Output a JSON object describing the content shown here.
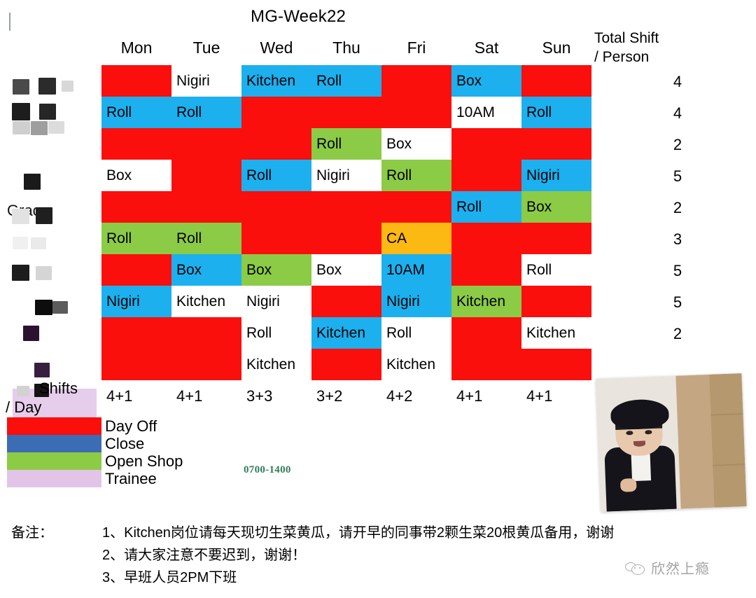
{
  "title": "MG-Week22",
  "header": {
    "days": [
      "Mon",
      "Tue",
      "Wed",
      "Thu",
      "Fri",
      "Sat",
      "Sun"
    ],
    "total_line1": "Total Shift",
    "total_line2": "/ Person"
  },
  "name_column": {
    "visible_name": "Grace",
    "redacted": true
  },
  "schedule": {
    "rows": [
      {
        "total": "4",
        "cells": [
          {
            "day": "Mon",
            "text": "",
            "color": "red"
          },
          {
            "day": "Tue",
            "text": "Nigiri",
            "color": "white"
          },
          {
            "day": "Wed",
            "text": "Kitchen",
            "color": "blue"
          },
          {
            "day": "Thu",
            "text": "Roll",
            "color": "blue"
          },
          {
            "day": "Fri",
            "text": "",
            "color": "red"
          },
          {
            "day": "Sat",
            "text": "Box",
            "color": "blue"
          },
          {
            "day": "Sun",
            "text": "",
            "color": "red"
          }
        ]
      },
      {
        "total": "4",
        "cells": [
          {
            "day": "Mon",
            "text": "Roll",
            "color": "blue"
          },
          {
            "day": "Tue",
            "text": "Roll",
            "color": "blue"
          },
          {
            "day": "Wed",
            "text": "",
            "color": "red"
          },
          {
            "day": "Thu",
            "text": "",
            "color": "red"
          },
          {
            "day": "Fri",
            "text": "",
            "color": "red"
          },
          {
            "day": "Sat",
            "text": "10AM",
            "color": "white"
          },
          {
            "day": "Sun",
            "text": "Roll",
            "color": "blue"
          }
        ]
      },
      {
        "total": "2",
        "cells": [
          {
            "day": "Mon",
            "text": "",
            "color": "red"
          },
          {
            "day": "Tue",
            "text": "",
            "color": "red"
          },
          {
            "day": "Wed",
            "text": "",
            "color": "red"
          },
          {
            "day": "Thu",
            "text": "Roll",
            "color": "green"
          },
          {
            "day": "Fri",
            "text": "Box",
            "color": "white"
          },
          {
            "day": "Sat",
            "text": "",
            "color": "red"
          },
          {
            "day": "Sun",
            "text": "",
            "color": "red"
          }
        ]
      },
      {
        "total": "5",
        "cells": [
          {
            "day": "Mon",
            "text": "Box",
            "color": "white"
          },
          {
            "day": "Tue",
            "text": "",
            "color": "red"
          },
          {
            "day": "Wed",
            "text": "Roll",
            "color": "blue"
          },
          {
            "day": "Thu",
            "text": "Nigiri",
            "color": "white"
          },
          {
            "day": "Fri",
            "text": "Roll",
            "color": "green"
          },
          {
            "day": "Sat",
            "text": "",
            "color": "red"
          },
          {
            "day": "Sun",
            "text": "Nigiri",
            "color": "blue"
          }
        ]
      },
      {
        "total": "2",
        "cells": [
          {
            "day": "Mon",
            "text": "",
            "color": "red"
          },
          {
            "day": "Tue",
            "text": "",
            "color": "red"
          },
          {
            "day": "Wed",
            "text": "",
            "color": "red"
          },
          {
            "day": "Thu",
            "text": "",
            "color": "red"
          },
          {
            "day": "Fri",
            "text": "",
            "color": "red"
          },
          {
            "day": "Sat",
            "text": "Roll",
            "color": "blue"
          },
          {
            "day": "Sun",
            "text": "Box",
            "color": "green"
          }
        ]
      },
      {
        "total": "3",
        "cells": [
          {
            "day": "Mon",
            "text": "Roll",
            "color": "green"
          },
          {
            "day": "Tue",
            "text": "Roll",
            "color": "green"
          },
          {
            "day": "Wed",
            "text": "",
            "color": "red"
          },
          {
            "day": "Thu",
            "text": "",
            "color": "red"
          },
          {
            "day": "Fri",
            "text": "CA",
            "color": "orange"
          },
          {
            "day": "Sat",
            "text": "",
            "color": "red"
          },
          {
            "day": "Sun",
            "text": "",
            "color": "red"
          }
        ]
      },
      {
        "total": "5",
        "cells": [
          {
            "day": "Mon",
            "text": "",
            "color": "red"
          },
          {
            "day": "Tue",
            "text": "Box",
            "color": "blue"
          },
          {
            "day": "Wed",
            "text": "Box",
            "color": "green"
          },
          {
            "day": "Thu",
            "text": "Box",
            "color": "white"
          },
          {
            "day": "Fri",
            "text": "10AM",
            "color": "blue"
          },
          {
            "day": "Sat",
            "text": "",
            "color": "red"
          },
          {
            "day": "Sun",
            "text": "Roll",
            "color": "white"
          }
        ]
      },
      {
        "total": "5",
        "cells": [
          {
            "day": "Mon",
            "text": "Nigiri",
            "color": "blue"
          },
          {
            "day": "Tue",
            "text": "Kitchen",
            "color": "white"
          },
          {
            "day": "Wed",
            "text": "Nigiri",
            "color": "white"
          },
          {
            "day": "Thu",
            "text": "",
            "color": "red"
          },
          {
            "day": "Fri",
            "text": "Nigiri",
            "color": "blue"
          },
          {
            "day": "Sat",
            "text": "Kitchen",
            "color": "green"
          },
          {
            "day": "Sun",
            "text": "",
            "color": "red"
          }
        ]
      },
      {
        "total": "2",
        "cells": [
          {
            "day": "Mon",
            "text": "",
            "color": "red"
          },
          {
            "day": "Tue",
            "text": "",
            "color": "red"
          },
          {
            "day": "Wed",
            "text": "Roll",
            "color": "white"
          },
          {
            "day": "Thu",
            "text": "Kitchen",
            "color": "blue"
          },
          {
            "day": "Fri",
            "text": "Roll",
            "color": "white"
          },
          {
            "day": "Sat",
            "text": "",
            "color": "red"
          },
          {
            "day": "Sun",
            "text": "Kitchen",
            "color": "white"
          }
        ]
      },
      {
        "total": "",
        "cells": [
          {
            "day": "Mon",
            "text": "",
            "color": "red"
          },
          {
            "day": "Tue",
            "text": "",
            "color": "red"
          },
          {
            "day": "Wed",
            "text": "Kitchen",
            "color": "white"
          },
          {
            "day": "Thu",
            "text": "",
            "color": "red"
          },
          {
            "day": "Fri",
            "text": "Kitchen",
            "color": "white"
          },
          {
            "day": "Sat",
            "text": "",
            "color": "red"
          },
          {
            "day": "Sun",
            "text": "",
            "color": "red"
          }
        ]
      }
    ]
  },
  "shifts_per_day": {
    "label_line1": "Shifts",
    "label_line2": "/ Day",
    "values": [
      "4+1",
      "4+1",
      "3+3",
      "3+2",
      "4+2",
      "4+1",
      "4+1"
    ]
  },
  "legend": {
    "items": [
      {
        "label": "Day Off",
        "color": "#fa0f0c"
      },
      {
        "label": "Close",
        "color": "#3c6cb4"
      },
      {
        "label": "Open Shop",
        "color": "#8ccb46"
      },
      {
        "label": "Trainee",
        "color": "#e2c4e8"
      }
    ],
    "time_note": "0700-1400"
  },
  "notes": {
    "label": "备注：",
    "lines": [
      "1、Kitchen岗位请每天现切生菜黄瓜，请开早的同事带2颗生菜20根黄瓜备用，谢谢",
      "2、请大家注意不要迟到，谢谢！",
      "3、早班人员2PM下班"
    ]
  },
  "watermark": {
    "text": "欣然上瘾"
  },
  "colors": {
    "red": "#fa0f0c",
    "blue": "#1cb0ef",
    "green": "#8ccb46",
    "orange": "#fdb913",
    "white": "#ffffff",
    "close_blue": "#3c6cb4",
    "trainee": "#e2c4e8"
  }
}
